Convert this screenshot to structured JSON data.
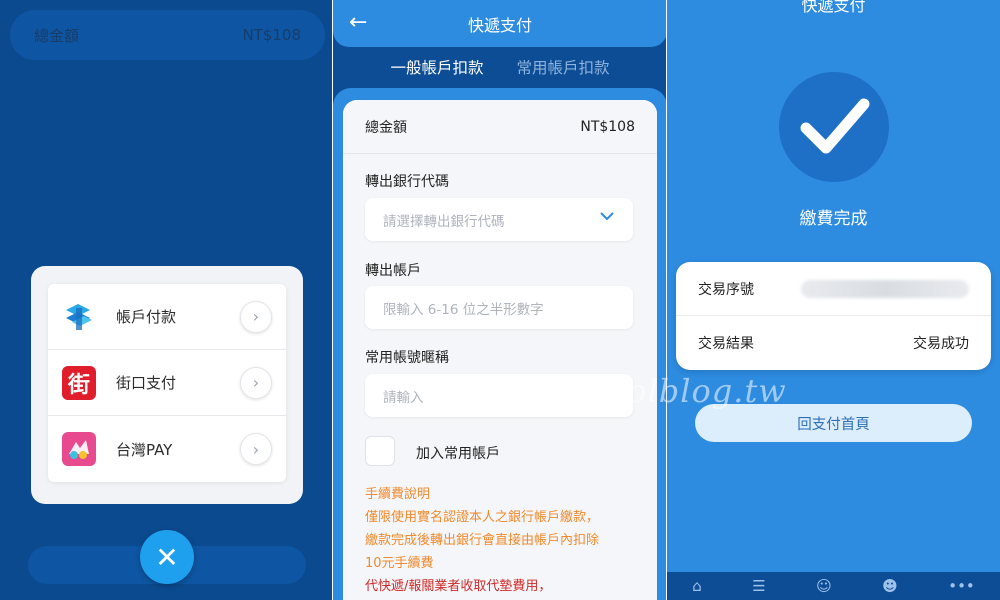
{
  "left": {
    "top_label": "總金額",
    "top_value": "NT$108",
    "payment_options": [
      {
        "label": "帳戶付款",
        "icon": "account-transfer-icon"
      },
      {
        "label": "街口支付",
        "icon": "jkopay-icon",
        "logo_char": "街"
      },
      {
        "label": "台灣PAY",
        "icon": "taiwan-pay-icon"
      }
    ],
    "close_icon": "close-icon"
  },
  "middle": {
    "title": "快遞支付",
    "tabs": [
      "一般帳戶扣款",
      "常用帳戶扣款"
    ],
    "total_label": "總金額",
    "total_value": "NT$108",
    "bank_code_label": "轉出銀行代碼",
    "bank_code_placeholder": "請選擇轉出銀行代碼",
    "account_label": "轉出帳戶",
    "account_placeholder": "限輸入 6-16 位之半形數字",
    "nickname_label": "常用帳號暱稱",
    "nickname_placeholder": "請輸入",
    "save_checkbox_label": "加入常用帳戶",
    "notes": [
      "手續費說明",
      "僅限使用實名認證本人之銀行帳戶繳款，",
      "繳款完成後轉出銀行會直接由帳戶內扣除",
      "10元手續費",
      "代快遞/報關業者收取代墊費用，"
    ]
  },
  "right": {
    "title": "快遞支付",
    "status": "繳費完成",
    "txn_no_label": "交易序號",
    "txn_result_label": "交易結果",
    "txn_result_value": "交易成功",
    "back_button": "回支付首頁",
    "nav_icons": [
      "home-icon",
      "list-icon",
      "smile-icon",
      "face-icon",
      "more-icon"
    ]
  },
  "watermark": "carolblog.tw",
  "colors": {
    "primary": "#2d8be0",
    "dark": "#0d4d96",
    "accent_orange": "#f18a2b",
    "accent_red": "#d12a2a",
    "fab": "#1fa0ee"
  }
}
